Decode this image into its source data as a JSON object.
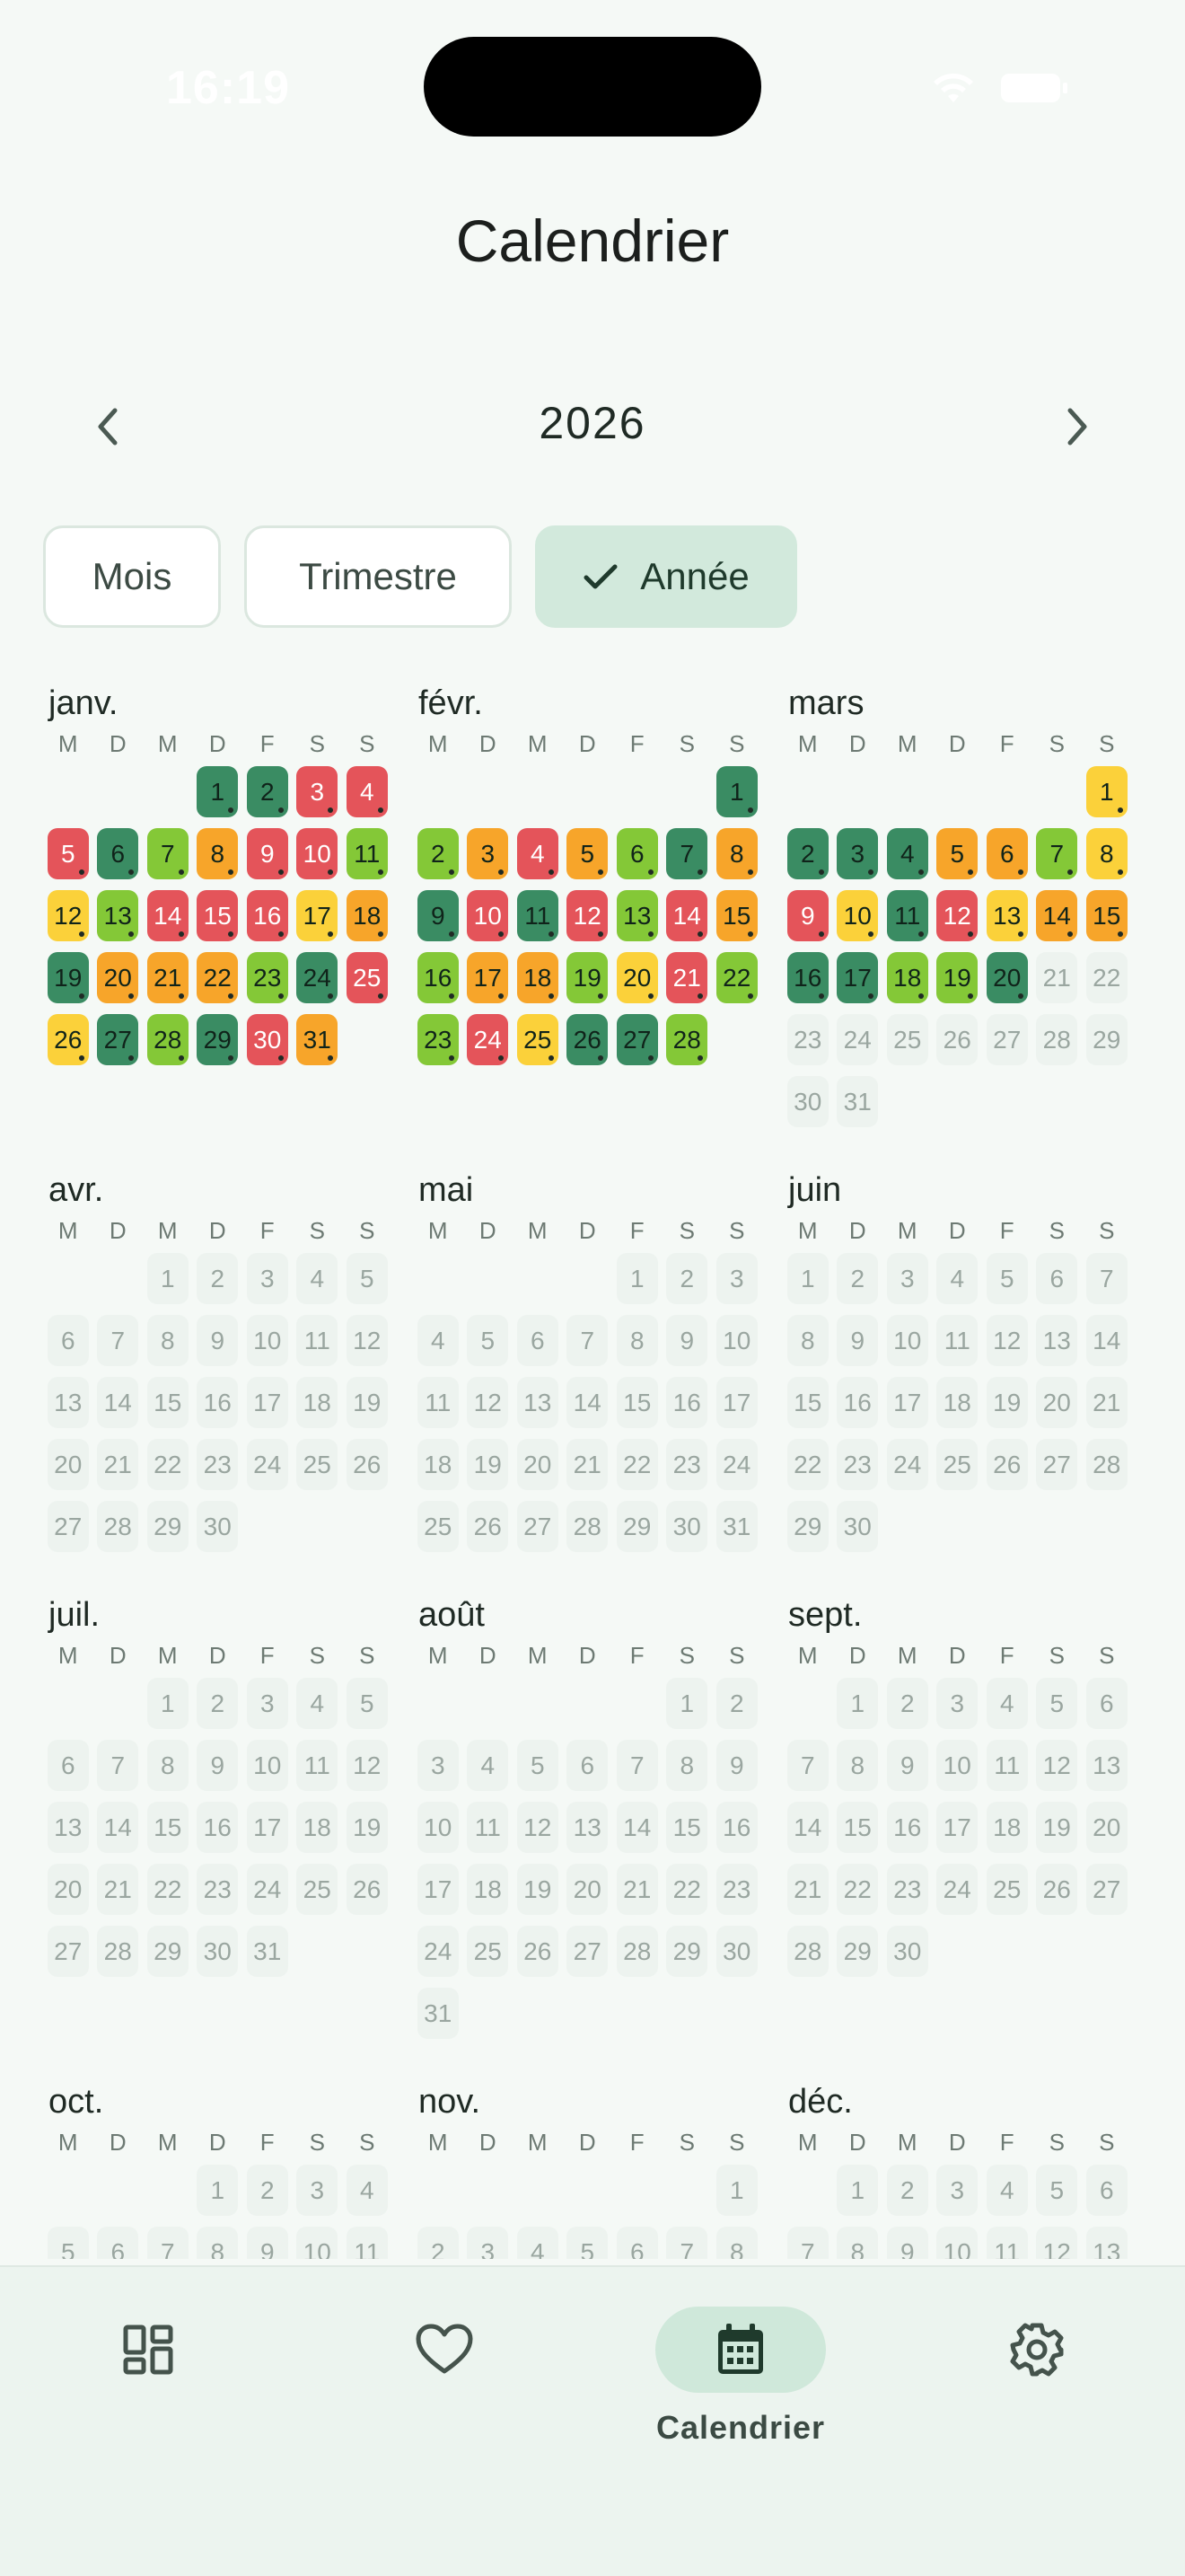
{
  "status": {
    "time": "16:19"
  },
  "title": "Calendrier",
  "year": "2026",
  "segments": [
    "Mois",
    "Trimestre",
    "Année"
  ],
  "weekdays": [
    "M",
    "D",
    "M",
    "D",
    "F",
    "S",
    "S"
  ],
  "colors": {
    "dark_green": "#3a8c63",
    "green": "#84c837",
    "yellow": "#fbd13a",
    "orange": "#f7a52a",
    "red": "#e4545a",
    "empty_cell": "#edf3ef"
  },
  "months": [
    {
      "name": "janv.",
      "offset": 3,
      "days": 31,
      "colored": {
        "1": "dark_green",
        "2": "dark_green",
        "3": "red",
        "4": "red",
        "5": "red",
        "6": "dark_green",
        "7": "green",
        "8": "orange",
        "9": "red",
        "10": "red",
        "11": "green",
        "12": "yellow",
        "13": "green",
        "14": "red",
        "15": "red",
        "16": "red",
        "17": "yellow",
        "18": "orange",
        "19": "dark_green",
        "20": "orange",
        "21": "orange",
        "22": "orange",
        "23": "green",
        "24": "dark_green",
        "25": "red",
        "26": "yellow",
        "27": "dark_green",
        "28": "green",
        "29": "dark_green",
        "30": "red",
        "31": "orange"
      }
    },
    {
      "name": "févr.",
      "offset": 6,
      "days": 28,
      "colored": {
        "1": "dark_green",
        "2": "green",
        "3": "orange",
        "4": "red",
        "5": "orange",
        "6": "green",
        "7": "dark_green",
        "8": "orange",
        "9": "dark_green",
        "10": "red",
        "11": "dark_green",
        "12": "red",
        "13": "green",
        "14": "red",
        "15": "orange",
        "16": "green",
        "17": "orange",
        "18": "orange",
        "19": "green",
        "20": "yellow",
        "21": "red",
        "22": "green",
        "23": "green",
        "24": "red",
        "25": "yellow",
        "26": "dark_green",
        "27": "dark_green",
        "28": "green"
      }
    },
    {
      "name": "mars",
      "offset": 6,
      "days": 31,
      "colored": {
        "1": "yellow",
        "2": "dark_green",
        "3": "dark_green",
        "4": "dark_green",
        "5": "orange",
        "6": "orange",
        "7": "green",
        "8": "yellow",
        "9": "red",
        "10": "yellow",
        "11": "dark_green",
        "12": "red",
        "13": "yellow",
        "14": "orange",
        "15": "orange",
        "16": "dark_green",
        "17": "dark_green",
        "18": "green",
        "19": "green",
        "20": "dark_green"
      }
    },
    {
      "name": "avr.",
      "offset": 2,
      "days": 30,
      "colored": {}
    },
    {
      "name": "mai",
      "offset": 4,
      "days": 31,
      "colored": {}
    },
    {
      "name": "juin",
      "offset": 0,
      "days": 30,
      "colored": {}
    },
    {
      "name": "juil.",
      "offset": 2,
      "days": 31,
      "colored": {}
    },
    {
      "name": "août",
      "offset": 5,
      "days": 31,
      "colored": {}
    },
    {
      "name": "sept.",
      "offset": 1,
      "days": 30,
      "colored": {}
    },
    {
      "name": "oct.",
      "offset": 3,
      "days": 31,
      "colored": {}
    },
    {
      "name": "nov.",
      "offset": 6,
      "days": 30,
      "colored": {}
    },
    {
      "name": "déc.",
      "offset": 1,
      "days": 31,
      "colored": {}
    }
  ],
  "tabs": [
    {
      "name": "dashboard",
      "icon": "dashboard-icon",
      "label": ""
    },
    {
      "name": "favorites",
      "icon": "heart-icon",
      "label": ""
    },
    {
      "name": "calendar",
      "icon": "calendar-icon",
      "label": "Calendrier"
    },
    {
      "name": "settings",
      "icon": "gear-icon",
      "label": ""
    }
  ]
}
